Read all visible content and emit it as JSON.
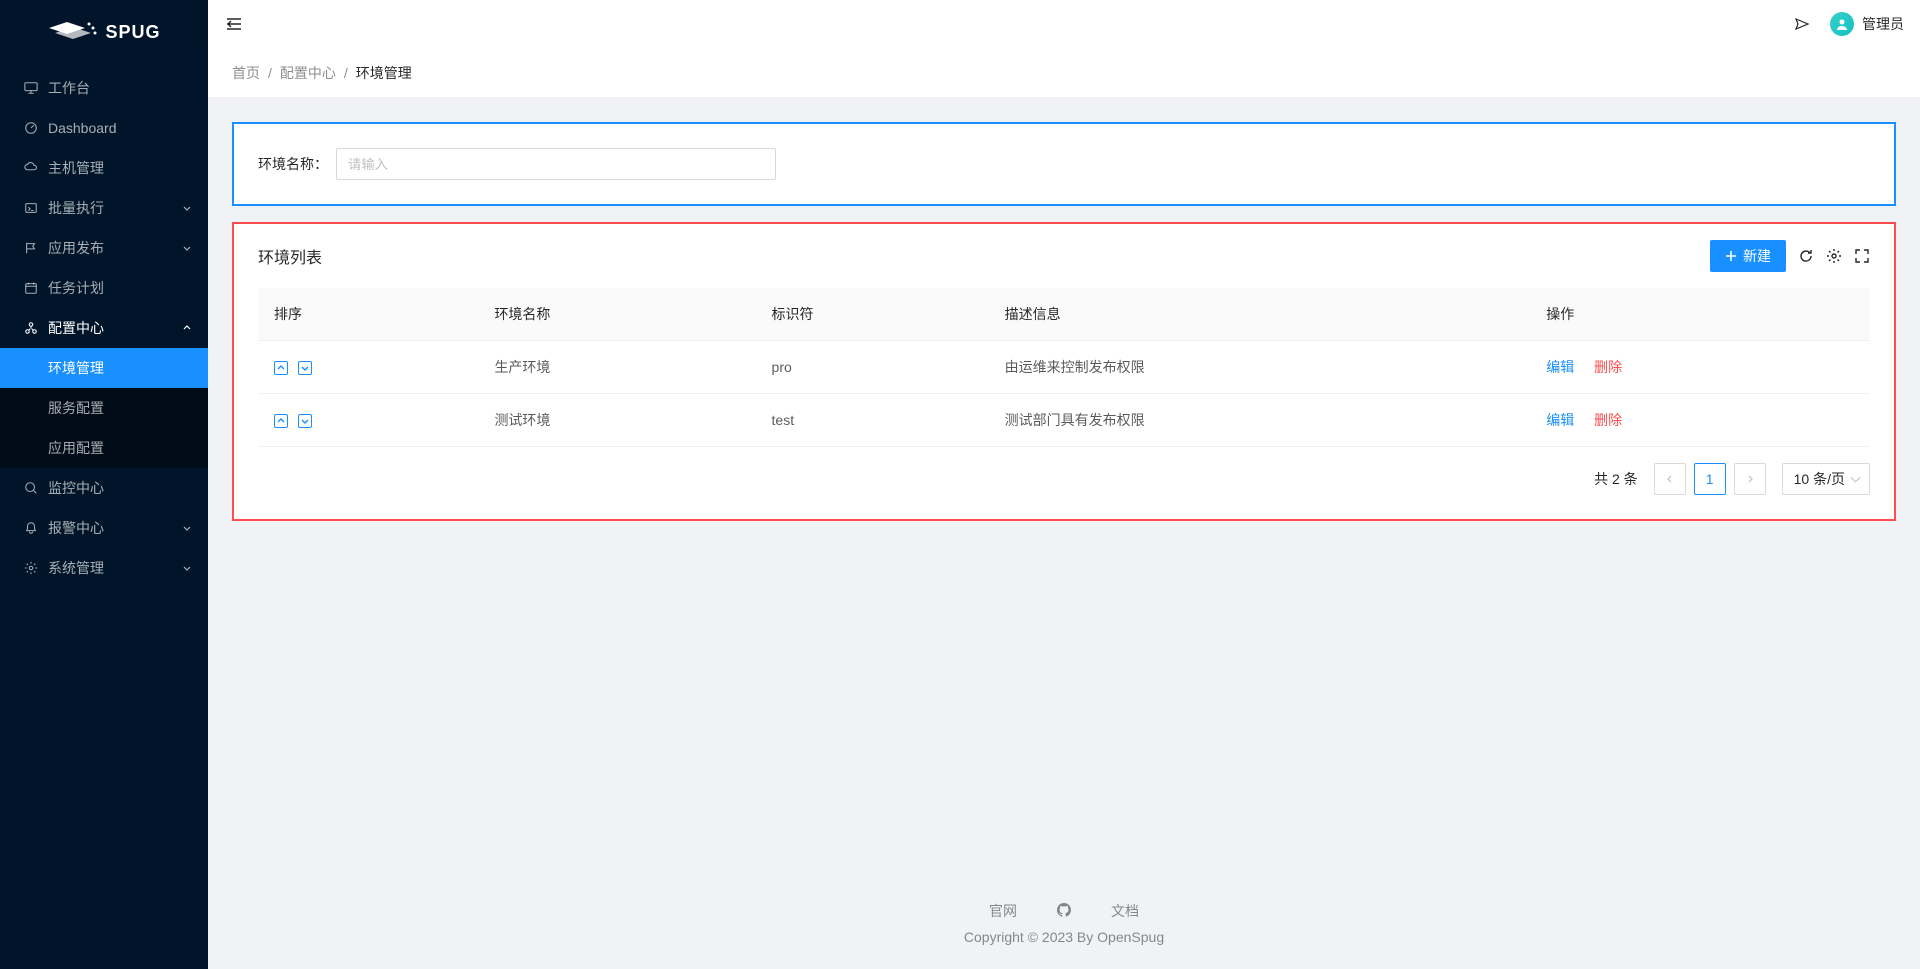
{
  "brand": {
    "name": "SPUG"
  },
  "header": {
    "username": "管理员"
  },
  "sidebar": {
    "items": [
      {
        "label": "工作台"
      },
      {
        "label": "Dashboard"
      },
      {
        "label": "主机管理"
      },
      {
        "label": "批量执行"
      },
      {
        "label": "应用发布"
      },
      {
        "label": "任务计划"
      },
      {
        "label": "配置中心"
      },
      {
        "label": "监控中心"
      },
      {
        "label": "报警中心"
      },
      {
        "label": "系统管理"
      }
    ],
    "config_submenu": [
      {
        "label": "环境管理"
      },
      {
        "label": "服务配置"
      },
      {
        "label": "应用配置"
      }
    ]
  },
  "breadcrumb": {
    "home": "首页",
    "mid": "配置中心",
    "current": "环境管理"
  },
  "search": {
    "label": "环境名称：",
    "placeholder": "请输入"
  },
  "table": {
    "title": "环境列表",
    "new_btn": "新建",
    "columns": {
      "sort": "排序",
      "name": "环境名称",
      "identifier": "标识符",
      "desc": "描述信息",
      "action": "操作"
    },
    "rows": [
      {
        "name": "生产环境",
        "identifier": "pro",
        "desc": "由运维来控制发布权限"
      },
      {
        "name": "测试环境",
        "identifier": "test",
        "desc": "测试部门具有发布权限"
      }
    ],
    "actions": {
      "edit": "编辑",
      "delete": "删除"
    }
  },
  "pagination": {
    "total": "共 2 条",
    "current": "1",
    "page_size": "10 条/页"
  },
  "footer": {
    "site": "官网",
    "docs": "文档",
    "copyright": "Copyright © 2023 By OpenSpug"
  }
}
